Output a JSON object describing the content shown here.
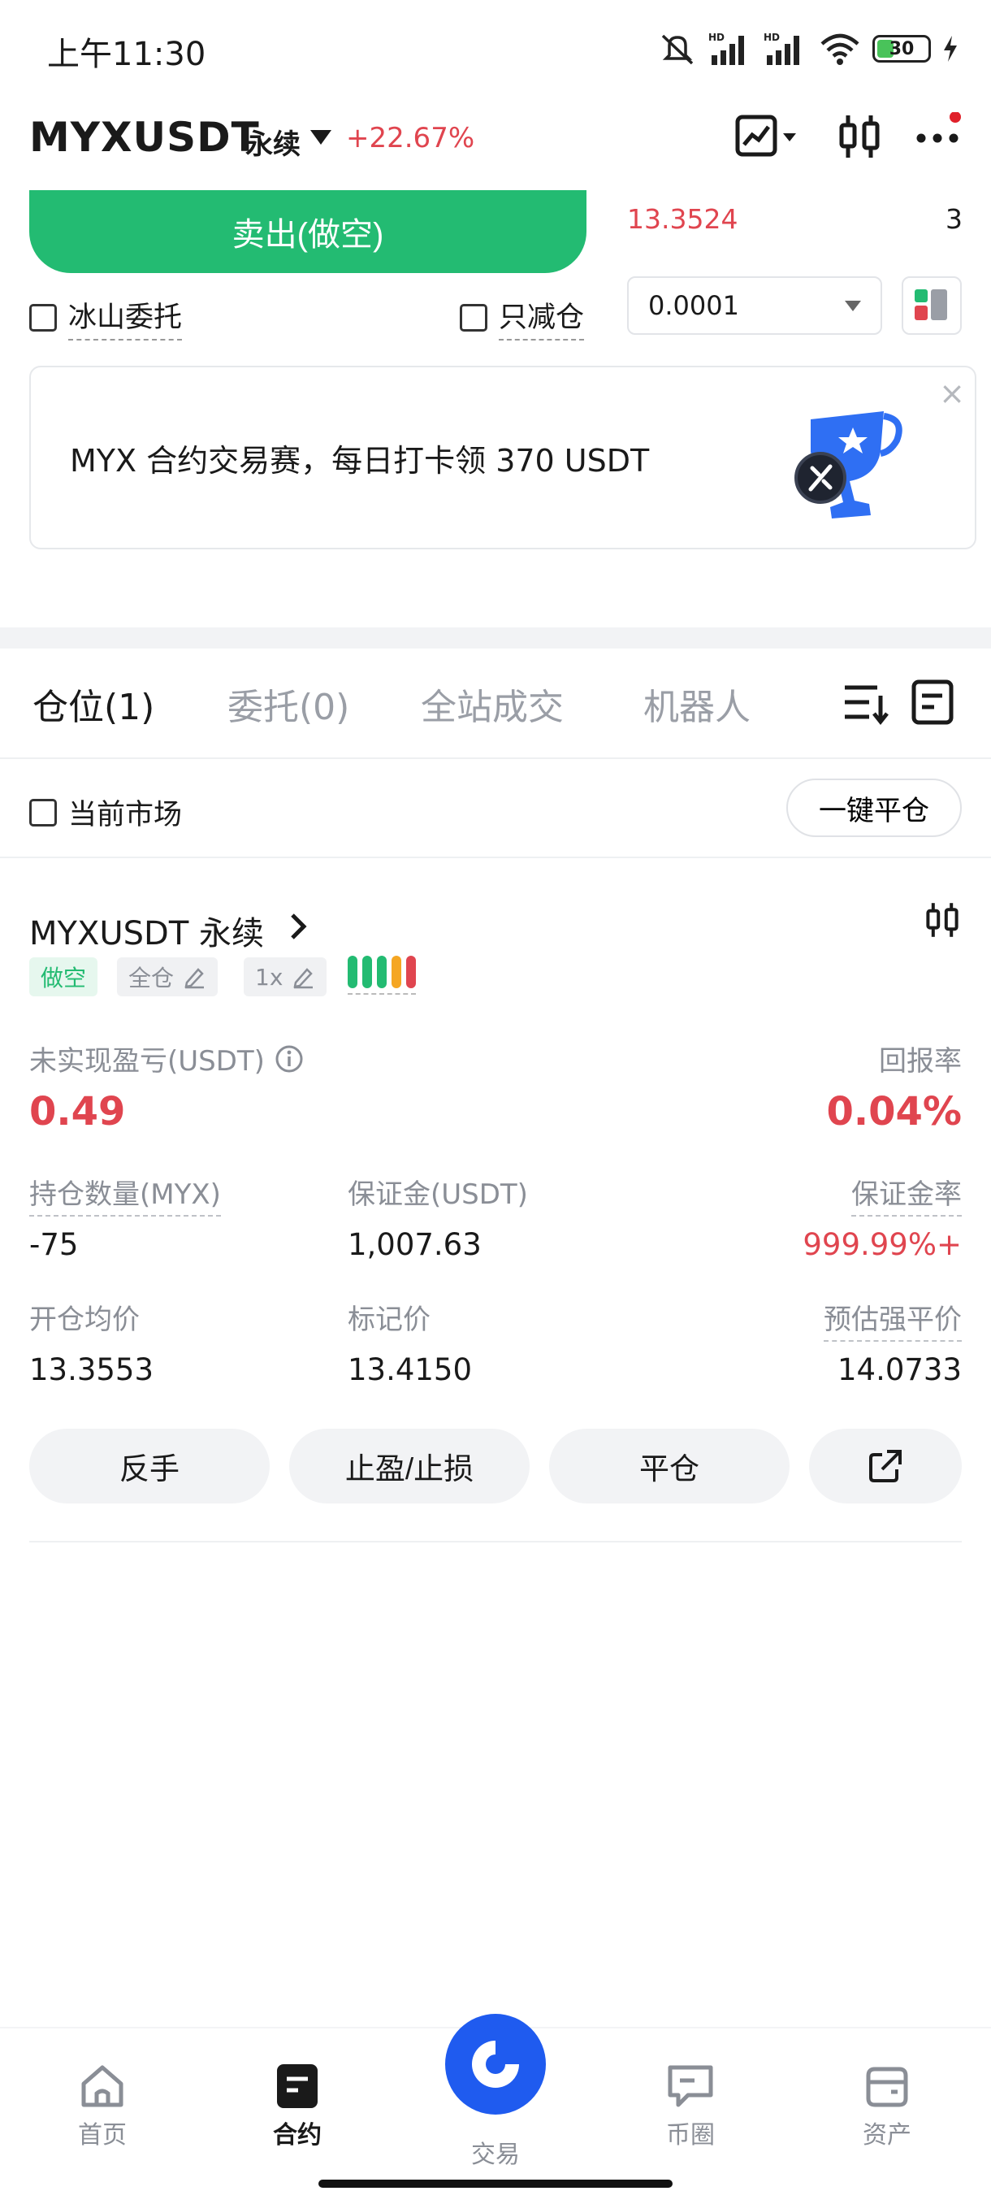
{
  "status_bar": {
    "time": "上午11:30",
    "battery": "30",
    "icons": [
      "mute-icon",
      "signal-hd-icon",
      "signal-hd-icon",
      "wifi-icon",
      "battery-icon",
      "charging-icon"
    ]
  },
  "header": {
    "symbol": "MYXUSDT",
    "contract_type": "永续",
    "change": "+22.67%",
    "icons": [
      "chart-icon",
      "candlestick-icon",
      "more-icon"
    ],
    "notification_dot_color": "#e0202a"
  },
  "order_panel": {
    "sell_button": "卖出(做空)",
    "orderbook_price": "13.3524",
    "orderbook_qty": "3",
    "iceberg_label": "冰山委托",
    "reduce_only_label": "只减仓",
    "precision_value": "0.0001"
  },
  "banner": {
    "text": "MYX 合约交易赛，每日打卡领 370 USDT",
    "close": "×"
  },
  "tabs": {
    "items": [
      "仓位(1)",
      "委托(0)",
      "全站成交",
      "机器人"
    ],
    "active": "仓位(1)"
  },
  "filter": {
    "current_market_label": "当前市场",
    "close_all_button": "一键平仓"
  },
  "position": {
    "title": "MYXUSDT 永续",
    "side_tag": "做空",
    "margin_mode_tag": "全仓",
    "leverage_tag": "1x",
    "unrealized_pnl_label": "未实现盈亏(USDT)",
    "unrealized_pnl": "0.49",
    "roe_label": "回报率",
    "roe": "0.04%",
    "size_label": "持仓数量(MYX)",
    "size": "-75",
    "margin_label": "保证金(USDT)",
    "margin": "1,007.63",
    "margin_ratio_label": "保证金率",
    "margin_ratio": "999.99%+",
    "entry_price_label": "开仓均价",
    "entry_price": "13.3553",
    "mark_price_label": "标记价",
    "mark_price": "13.4150",
    "liq_price_label": "预估强平价",
    "liq_price": "14.0733",
    "actions": {
      "reverse": "反手",
      "tp_sl": "止盈/止损",
      "close": "平仓"
    }
  },
  "bottom_nav": {
    "items": [
      "首页",
      "合约",
      "交易",
      "币圈",
      "资产"
    ],
    "active": "合约"
  },
  "colors": {
    "green": "#23bb72",
    "red": "#e0454f",
    "brand_blue": "#1f5bef"
  }
}
